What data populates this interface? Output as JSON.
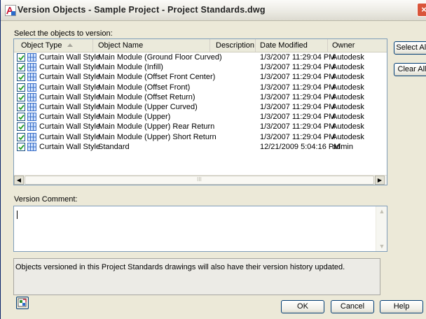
{
  "window": {
    "title": "Version Objects - Sample Project - Project Standards.dwg",
    "close_label": "×"
  },
  "select_label": "Select the objects to version:",
  "table": {
    "columns": [
      "Object Type",
      "Object Name",
      "Description",
      "Date Modified",
      "Owner"
    ],
    "rows": [
      {
        "type": "Curtain Wall Style",
        "name": "Main Module (Ground Floor Curved)",
        "description": "",
        "date": "1/3/2007 11:29:04 PM",
        "owner": "Autodesk",
        "checked": true
      },
      {
        "type": "Curtain Wall Style",
        "name": "Main Module (Infill)",
        "description": "",
        "date": "1/3/2007 11:29:04 PM",
        "owner": "Autodesk",
        "checked": true
      },
      {
        "type": "Curtain Wall Style",
        "name": "Main Module (Offset Front Center)",
        "description": "",
        "date": "1/3/2007 11:29:04 PM",
        "owner": "Autodesk",
        "checked": true
      },
      {
        "type": "Curtain Wall Style",
        "name": "Main Module (Offset Front)",
        "description": "",
        "date": "1/3/2007 11:29:04 PM",
        "owner": "Autodesk",
        "checked": true
      },
      {
        "type": "Curtain Wall Style",
        "name": "Main Module (Offset Return)",
        "description": "",
        "date": "1/3/2007 11:29:04 PM",
        "owner": "Autodesk",
        "checked": true
      },
      {
        "type": "Curtain Wall Style",
        "name": "Main Module (Upper Curved)",
        "description": "",
        "date": "1/3/2007 11:29:04 PM",
        "owner": "Autodesk",
        "checked": true
      },
      {
        "type": "Curtain Wall Style",
        "name": "Main Module (Upper)",
        "description": "",
        "date": "1/3/2007 11:29:04 PM",
        "owner": "Autodesk",
        "checked": true
      },
      {
        "type": "Curtain Wall Style",
        "name": "Main Module (Upper) Rear Return",
        "description": "",
        "date": "1/3/2007 11:29:04 PM",
        "owner": "Autodesk",
        "checked": true
      },
      {
        "type": "Curtain Wall Style",
        "name": "Main Module (Upper) Short Return",
        "description": "",
        "date": "1/3/2007 11:29:04 PM",
        "owner": "Autodesk",
        "checked": true
      },
      {
        "type": "Curtain Wall Style",
        "name": "Standard",
        "description": "",
        "date": "12/21/2009 5:04:16 PM",
        "owner": "admin",
        "checked": true
      }
    ],
    "hscroll_thumb": "III"
  },
  "buttons": {
    "select_all": "Select All",
    "clear_all": "Clear All",
    "ok": "OK",
    "cancel": "Cancel",
    "help": "Help"
  },
  "comment": {
    "label": "Version Comment:",
    "value": ""
  },
  "info_text": "Objects versioned in this Project Standards drawings will also have their version history updated.",
  "icons": {
    "app": "autocad-app-icon",
    "row": "curtain-wall-style-icon",
    "sort": "sort-ascending-icon",
    "bottom": "object-viewer-icon"
  },
  "colors": {
    "window_bg": "#ece9d8",
    "button_border": "#003c74",
    "check_green": "#21a121",
    "row_icon_blue": "#3a6fc8"
  }
}
